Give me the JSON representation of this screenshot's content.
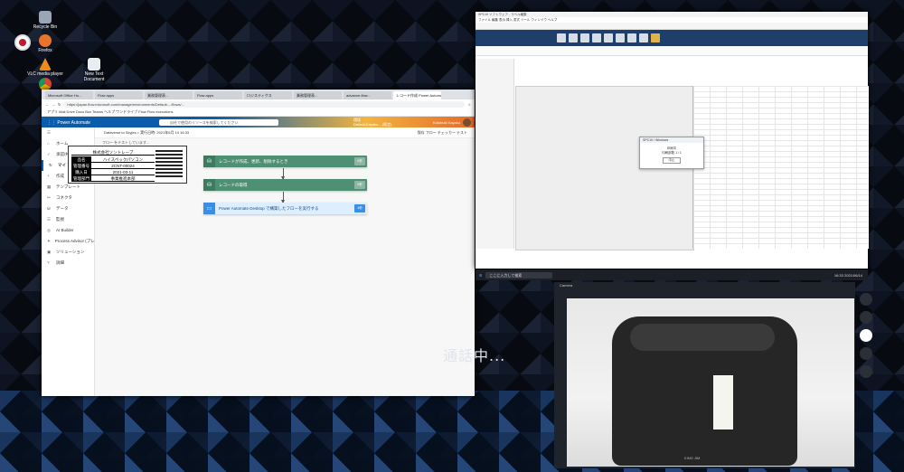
{
  "desktop": {
    "icons": [
      {
        "label": "Recycle Bin"
      },
      {
        "label": "Firefox"
      },
      {
        "label": "VLC media player"
      },
      {
        "label": "New Text Document"
      },
      {
        "label": "Chrome"
      }
    ]
  },
  "browser": {
    "tabs": [
      "Microsoft Office Ho...",
      "Flow apps",
      "業務管理表...",
      "Flow apps",
      "ロジスティクス",
      "業務管理表...",
      "advance-flow...",
      "レコード作成 Power Automate"
    ],
    "url": "https://japan.flow.microsoft.com/manage/environments/Default-.../flows/...",
    "bookmarks": "アプリ  Mail  Drive  Docs  Box  Teams  ヘルプ  ワンドライブ  Flow  Flow executions",
    "app_name": "Power Automate",
    "search_placeholder": "自社で使用のリソースを検索してください",
    "environment_line1": "環境",
    "environment_line2": "Default-Kayaku... (既定)",
    "user": "Kotobuki Kayaku",
    "breadcrumb": "Dataverse to Skyjes > 実行日時: 2021年6月 14 16:33",
    "crumb_actions": "保存  フロー チェッカー  テスト",
    "saved_text": "フロー をテストしています...",
    "nav": [
      {
        "icon": "☰",
        "label": ""
      },
      {
        "icon": "⌂",
        "label": "ホーム"
      },
      {
        "icon": "✓",
        "label": "承認/共有"
      },
      {
        "icon": "↻",
        "label": "マイ フロー"
      },
      {
        "icon": "+",
        "label": "作成"
      },
      {
        "icon": "▦",
        "label": "テンプレート"
      },
      {
        "icon": "⚯",
        "label": "コネクタ"
      },
      {
        "icon": "⛁",
        "label": "データ"
      },
      {
        "icon": "☰",
        "label": "監視"
      },
      {
        "icon": "◎",
        "label": "AI Builder"
      },
      {
        "icon": "✦",
        "label": "Process Advisor (プレビュー)"
      },
      {
        "icon": "▣",
        "label": "ソリューション"
      },
      {
        "icon": "?",
        "label": "詳細"
      }
    ],
    "steps": [
      {
        "label": "レコードが作成、更新、削除するとき",
        "time": "0秒",
        "color": "#4f8f74"
      },
      {
        "label": "レコードの取得",
        "time": "0秒",
        "color": "#4f8f74"
      },
      {
        "label": "Power Automate Desktop で構築したフローを実行する",
        "time": "4秒",
        "color": "#3a8ee6"
      }
    ]
  },
  "remote": {
    "title": "SPC10 ソフトウェア - ラベル編集",
    "menu": "ファイル  編集  表示  挿入  書式  ツール  ウィンドウ  ヘルプ",
    "label_company": "株式会社ソントレーブ",
    "label_rows": [
      {
        "key": "品名",
        "value": "ハイスペックパソコン"
      },
      {
        "key": "管理番号",
        "value": "2CNT-00024"
      },
      {
        "key": "購入日",
        "value": "2021-03-11"
      },
      {
        "key": "管理部門",
        "value": "事業推進本部"
      }
    ],
    "dialog_title": "SPC10 / Windows",
    "dialog_text": "印刷中",
    "dialog_sub": "印刷部数 1 / 1",
    "dialog_button": "中止",
    "taskbar_search": "ここに入力して検索",
    "taskbar_clock": "16:33  2021/06/14"
  },
  "camera": {
    "title": "Camera",
    "printer_brand": "KING JIM"
  },
  "overlay": {
    "calling": "通話中..."
  }
}
